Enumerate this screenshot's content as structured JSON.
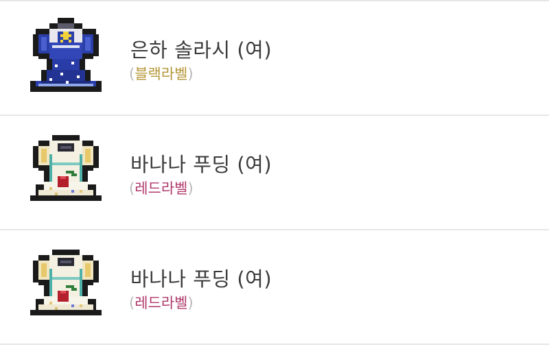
{
  "items": [
    {
      "name": "은하 솔라시 (여)",
      "label": "블랙라벨",
      "label_color": "#b49636",
      "icon": "galaxy-dress-icon"
    },
    {
      "name": "바나나 푸딩 (여)",
      "label": "레드라벨",
      "label_color": "#b0386a",
      "icon": "banana-pudding-dress-icon"
    },
    {
      "name": "바나나 푸딩 (여)",
      "label": "레드라벨",
      "label_color": "#b0386a",
      "icon": "banana-pudding-dress-icon"
    }
  ],
  "paren_open": "(",
  "paren_close": ")"
}
